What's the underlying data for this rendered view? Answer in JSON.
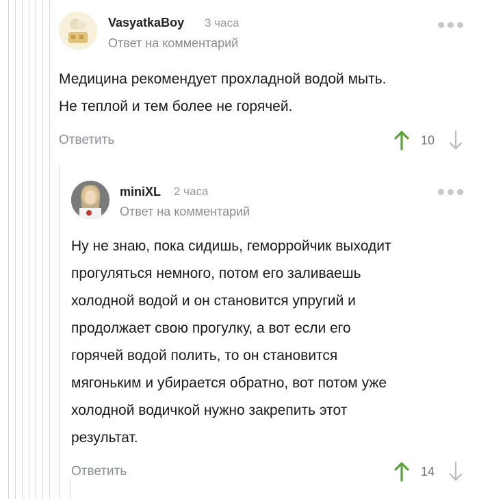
{
  "comment1": {
    "username": "VasyatkaBoy",
    "time": "3 часа",
    "reply_prefix": "Ответ на",
    "reply_link": "комментарий",
    "text_line1": "Медицина рекомендует прохладной водой мыть.",
    "text_line2": "Не теплой и тем  более не горячей.",
    "reply_label": "Ответить",
    "score": "10"
  },
  "comment2": {
    "username": "miniXL",
    "time": "2 часа",
    "reply_prefix": "Ответ на",
    "reply_link": "комментарий",
    "lines": [
      "Ну не знаю, пока сидишь, геморройчик выходит",
      "прогуляться немного, потом его заливаешь",
      "холодной водой и он становится упругий и",
      "продолжает свою прогулку, а вот если его",
      "горячей водой полить, то он становится",
      "мягоньким и убирается обратно, вот потом уже",
      "холодной водичкой нужно закрепить этот",
      "результат."
    ],
    "reply_label": "Ответить",
    "score": "14"
  },
  "colors": {
    "upvote": "#5aa33a",
    "downvote": "#b9bec4",
    "thread_line": "#d8d8d8"
  },
  "icons": [
    "more-icon",
    "upvote-arrow-icon",
    "downvote-arrow-icon",
    "avatar"
  ]
}
